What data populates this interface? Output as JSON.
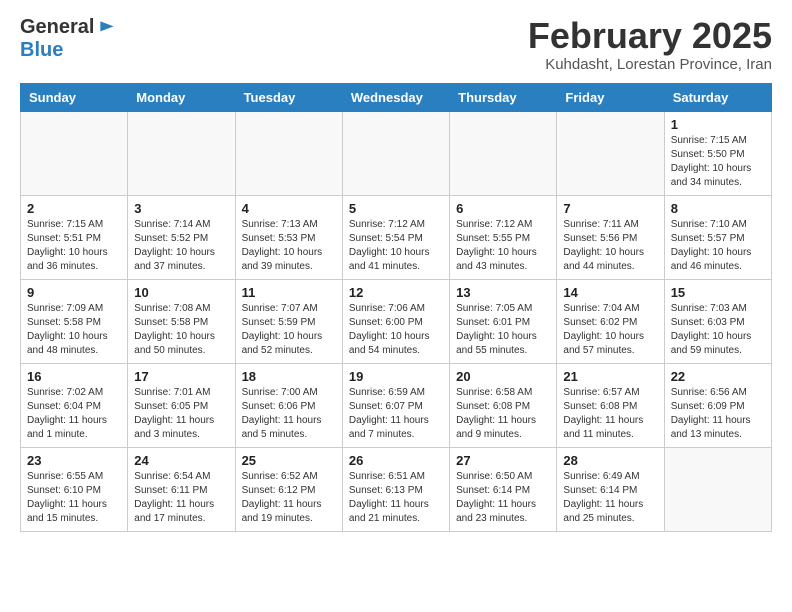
{
  "header": {
    "logo_general": "General",
    "logo_blue": "Blue",
    "month_year": "February 2025",
    "location": "Kuhdasht, Lorestan Province, Iran"
  },
  "weekdays": [
    "Sunday",
    "Monday",
    "Tuesday",
    "Wednesday",
    "Thursday",
    "Friday",
    "Saturday"
  ],
  "weeks": [
    [
      {
        "day": "",
        "info": ""
      },
      {
        "day": "",
        "info": ""
      },
      {
        "day": "",
        "info": ""
      },
      {
        "day": "",
        "info": ""
      },
      {
        "day": "",
        "info": ""
      },
      {
        "day": "",
        "info": ""
      },
      {
        "day": "1",
        "info": "Sunrise: 7:15 AM\nSunset: 5:50 PM\nDaylight: 10 hours\nand 34 minutes."
      }
    ],
    [
      {
        "day": "2",
        "info": "Sunrise: 7:15 AM\nSunset: 5:51 PM\nDaylight: 10 hours\nand 36 minutes."
      },
      {
        "day": "3",
        "info": "Sunrise: 7:14 AM\nSunset: 5:52 PM\nDaylight: 10 hours\nand 37 minutes."
      },
      {
        "day": "4",
        "info": "Sunrise: 7:13 AM\nSunset: 5:53 PM\nDaylight: 10 hours\nand 39 minutes."
      },
      {
        "day": "5",
        "info": "Sunrise: 7:12 AM\nSunset: 5:54 PM\nDaylight: 10 hours\nand 41 minutes."
      },
      {
        "day": "6",
        "info": "Sunrise: 7:12 AM\nSunset: 5:55 PM\nDaylight: 10 hours\nand 43 minutes."
      },
      {
        "day": "7",
        "info": "Sunrise: 7:11 AM\nSunset: 5:56 PM\nDaylight: 10 hours\nand 44 minutes."
      },
      {
        "day": "8",
        "info": "Sunrise: 7:10 AM\nSunset: 5:57 PM\nDaylight: 10 hours\nand 46 minutes."
      }
    ],
    [
      {
        "day": "9",
        "info": "Sunrise: 7:09 AM\nSunset: 5:58 PM\nDaylight: 10 hours\nand 48 minutes."
      },
      {
        "day": "10",
        "info": "Sunrise: 7:08 AM\nSunset: 5:58 PM\nDaylight: 10 hours\nand 50 minutes."
      },
      {
        "day": "11",
        "info": "Sunrise: 7:07 AM\nSunset: 5:59 PM\nDaylight: 10 hours\nand 52 minutes."
      },
      {
        "day": "12",
        "info": "Sunrise: 7:06 AM\nSunset: 6:00 PM\nDaylight: 10 hours\nand 54 minutes."
      },
      {
        "day": "13",
        "info": "Sunrise: 7:05 AM\nSunset: 6:01 PM\nDaylight: 10 hours\nand 55 minutes."
      },
      {
        "day": "14",
        "info": "Sunrise: 7:04 AM\nSunset: 6:02 PM\nDaylight: 10 hours\nand 57 minutes."
      },
      {
        "day": "15",
        "info": "Sunrise: 7:03 AM\nSunset: 6:03 PM\nDaylight: 10 hours\nand 59 minutes."
      }
    ],
    [
      {
        "day": "16",
        "info": "Sunrise: 7:02 AM\nSunset: 6:04 PM\nDaylight: 11 hours\nand 1 minute."
      },
      {
        "day": "17",
        "info": "Sunrise: 7:01 AM\nSunset: 6:05 PM\nDaylight: 11 hours\nand 3 minutes."
      },
      {
        "day": "18",
        "info": "Sunrise: 7:00 AM\nSunset: 6:06 PM\nDaylight: 11 hours\nand 5 minutes."
      },
      {
        "day": "19",
        "info": "Sunrise: 6:59 AM\nSunset: 6:07 PM\nDaylight: 11 hours\nand 7 minutes."
      },
      {
        "day": "20",
        "info": "Sunrise: 6:58 AM\nSunset: 6:08 PM\nDaylight: 11 hours\nand 9 minutes."
      },
      {
        "day": "21",
        "info": "Sunrise: 6:57 AM\nSunset: 6:08 PM\nDaylight: 11 hours\nand 11 minutes."
      },
      {
        "day": "22",
        "info": "Sunrise: 6:56 AM\nSunset: 6:09 PM\nDaylight: 11 hours\nand 13 minutes."
      }
    ],
    [
      {
        "day": "23",
        "info": "Sunrise: 6:55 AM\nSunset: 6:10 PM\nDaylight: 11 hours\nand 15 minutes."
      },
      {
        "day": "24",
        "info": "Sunrise: 6:54 AM\nSunset: 6:11 PM\nDaylight: 11 hours\nand 17 minutes."
      },
      {
        "day": "25",
        "info": "Sunrise: 6:52 AM\nSunset: 6:12 PM\nDaylight: 11 hours\nand 19 minutes."
      },
      {
        "day": "26",
        "info": "Sunrise: 6:51 AM\nSunset: 6:13 PM\nDaylight: 11 hours\nand 21 minutes."
      },
      {
        "day": "27",
        "info": "Sunrise: 6:50 AM\nSunset: 6:14 PM\nDaylight: 11 hours\nand 23 minutes."
      },
      {
        "day": "28",
        "info": "Sunrise: 6:49 AM\nSunset: 6:14 PM\nDaylight: 11 hours\nand 25 minutes."
      },
      {
        "day": "",
        "info": ""
      }
    ]
  ]
}
